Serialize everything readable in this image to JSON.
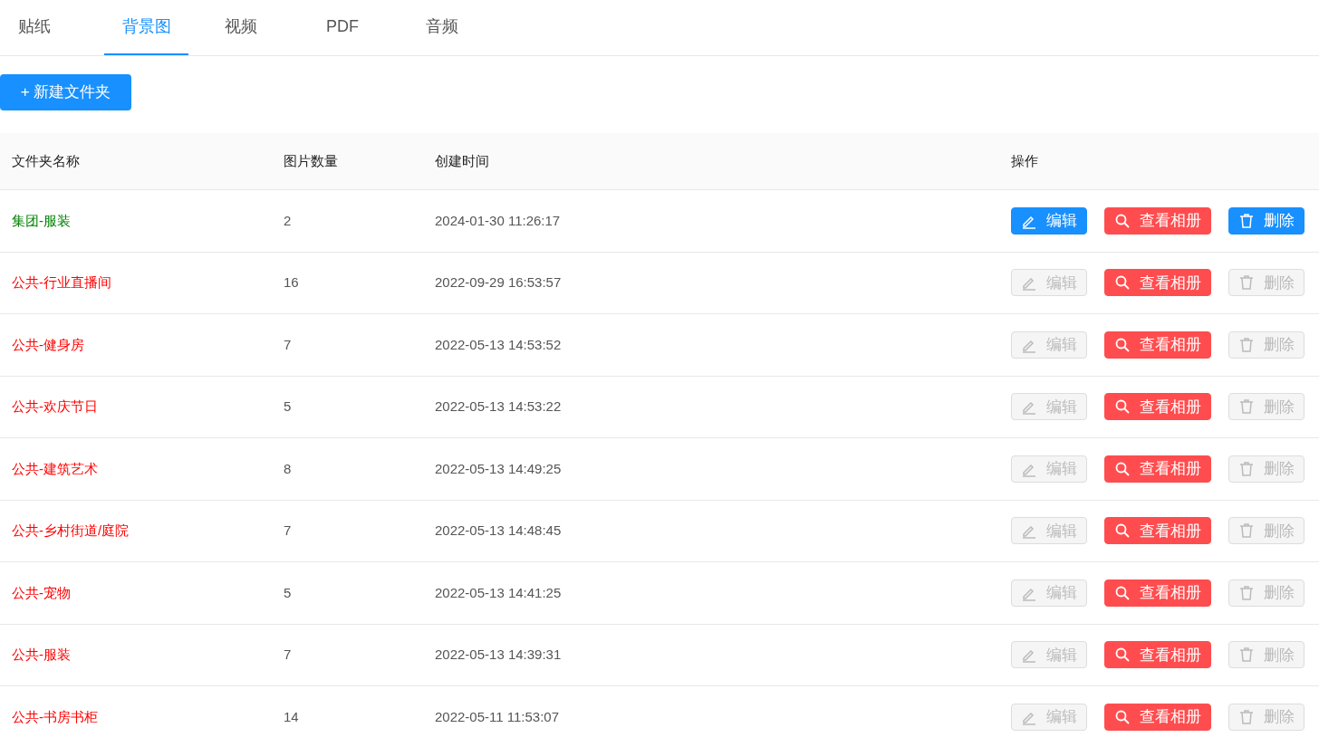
{
  "tabs": [
    {
      "label": "贴纸",
      "selected": false
    },
    {
      "label": "背景图",
      "selected": true
    },
    {
      "label": "视频",
      "selected": false
    },
    {
      "label": "PDF",
      "selected": false
    },
    {
      "label": "音频",
      "selected": false
    }
  ],
  "new_folder_button": "+ 新建文件夹",
  "table": {
    "columns": [
      "文件夹名称",
      "图片数量",
      "创建时间",
      "操作"
    ],
    "rows": [
      {
        "name": "集团-服装",
        "color": "#008000",
        "count": "2",
        "created": "2024-01-30 11:26:17",
        "buttons": [
          {
            "kind": "edit",
            "label": "编辑",
            "disabled": false
          },
          {
            "kind": "view",
            "label": "查看相册",
            "disabled": false
          },
          {
            "kind": "delete",
            "label": "删除",
            "disabled": false
          }
        ]
      },
      {
        "name": "公共-行业直播间",
        "color": "#ff0000",
        "count": "16",
        "created": "2022-09-29 16:53:57",
        "buttons": [
          {
            "kind": "edit",
            "label": "编辑",
            "disabled": true
          },
          {
            "kind": "view",
            "label": "查看相册",
            "disabled": false
          },
          {
            "kind": "delete",
            "label": "删除",
            "disabled": true
          }
        ]
      },
      {
        "name": "公共-健身房",
        "color": "#ff0000",
        "count": "7",
        "created": "2022-05-13 14:53:52",
        "buttons": [
          {
            "kind": "edit",
            "label": "编辑",
            "disabled": true
          },
          {
            "kind": "view",
            "label": "查看相册",
            "disabled": false
          },
          {
            "kind": "delete",
            "label": "删除",
            "disabled": true
          }
        ]
      },
      {
        "name": "公共-欢庆节日",
        "color": "#ff0000",
        "count": "5",
        "created": "2022-05-13 14:53:22",
        "buttons": [
          {
            "kind": "edit",
            "label": "编辑",
            "disabled": true
          },
          {
            "kind": "view",
            "label": "查看相册",
            "disabled": false
          },
          {
            "kind": "delete",
            "label": "删除",
            "disabled": true
          }
        ]
      },
      {
        "name": "公共-建筑艺术",
        "color": "#ff0000",
        "count": "8",
        "created": "2022-05-13 14:49:25",
        "buttons": [
          {
            "kind": "edit",
            "label": "编辑",
            "disabled": true
          },
          {
            "kind": "view",
            "label": "查看相册",
            "disabled": false
          },
          {
            "kind": "delete",
            "label": "删除",
            "disabled": true
          }
        ]
      },
      {
        "name": "公共-乡村街道/庭院",
        "color": "#ff0000",
        "count": "7",
        "created": "2022-05-13 14:48:45",
        "buttons": [
          {
            "kind": "edit",
            "label": "编辑",
            "disabled": true
          },
          {
            "kind": "view",
            "label": "查看相册",
            "disabled": false
          },
          {
            "kind": "delete",
            "label": "删除",
            "disabled": true
          }
        ]
      },
      {
        "name": "公共-宠物",
        "color": "#ff0000",
        "count": "5",
        "created": "2022-05-13 14:41:25",
        "buttons": [
          {
            "kind": "edit",
            "label": "编辑",
            "disabled": true
          },
          {
            "kind": "view",
            "label": "查看相册",
            "disabled": false
          },
          {
            "kind": "delete",
            "label": "删除",
            "disabled": true
          }
        ]
      },
      {
        "name": "公共-服装",
        "color": "#ff0000",
        "count": "7",
        "created": "2022-05-13 14:39:31",
        "buttons": [
          {
            "kind": "edit",
            "label": "编辑",
            "disabled": true
          },
          {
            "kind": "view",
            "label": "查看相册",
            "disabled": false
          },
          {
            "kind": "delete",
            "label": "删除",
            "disabled": true
          }
        ]
      },
      {
        "name": "公共-书房书柜",
        "color": "#ff0000",
        "count": "14",
        "created": "2022-05-11 11:53:07",
        "buttons": [
          {
            "kind": "edit",
            "label": "编辑",
            "disabled": true
          },
          {
            "kind": "view",
            "label": "查看相册",
            "disabled": false
          },
          {
            "kind": "delete",
            "label": "删除",
            "disabled": true
          }
        ]
      }
    ]
  }
}
